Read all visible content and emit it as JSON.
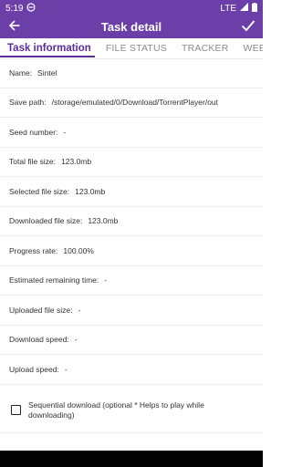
{
  "status_bar": {
    "time": "5:19",
    "network": "LTE",
    "icons": [
      "sync-icon",
      "wifi-icon",
      "signal-icon",
      "battery-icon"
    ]
  },
  "app_bar": {
    "title": "Task detail",
    "back_icon": "arrow-back-icon",
    "confirm_icon": "check-icon"
  },
  "tabs": [
    {
      "label": "Task information",
      "active": true
    },
    {
      "label": "FILE STATUS",
      "active": false
    },
    {
      "label": "TRACKER",
      "active": false
    },
    {
      "label": "WEBSEED",
      "active": false
    }
  ],
  "info": [
    {
      "label": "Name:",
      "value": "Sintel"
    },
    {
      "label": "Save path:",
      "value": "/storage/emulated/0/Download/TorrentPlayer/out"
    },
    {
      "label": "Seed number:",
      "value": "-"
    },
    {
      "label": "Total file size:",
      "value": "123.0mb"
    },
    {
      "label": "Selected file size:",
      "value": "123.0mb"
    },
    {
      "label": "Downloaded file size:",
      "value": "123.0mb"
    },
    {
      "label": "Progress rate:",
      "value": "100.00%"
    },
    {
      "label": "Estimated remaining time:",
      "value": "-"
    },
    {
      "label": "Uploaded file size:",
      "value": "-"
    },
    {
      "label": "Download speed:",
      "value": "-"
    },
    {
      "label": "Upload speed:",
      "value": "-"
    }
  ],
  "sequential": {
    "label": "Sequential download (optional * Helps to play while downloading)",
    "checked": false
  },
  "colors": {
    "primary": "#6c3fa8",
    "tab_active": "#5a2d9a",
    "tab_inactive": "#8c8c8c",
    "text": "#333333"
  }
}
